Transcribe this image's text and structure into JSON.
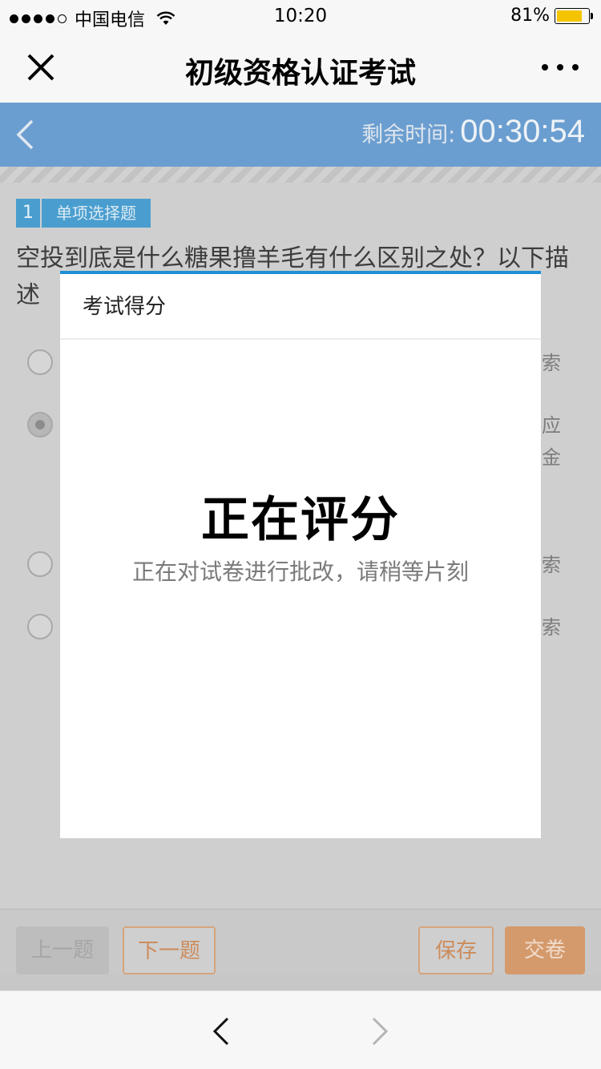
{
  "status_bar": {
    "carrier": "中国电信",
    "time": "10:20",
    "battery_percent": "81%",
    "battery_level": 0.81,
    "signal_bars": 4
  },
  "nav": {
    "title": "初级资格认证考试",
    "close_icon": "close-icon",
    "more_icon": "more-icon"
  },
  "exam_header": {
    "timer_label": "剩余时间:",
    "timer_value": "00:30:54"
  },
  "question": {
    "number": "1",
    "type": "单项选择题",
    "text": "空投到底是什么糖果撸羊毛有什么区别之处？以下描述"
  },
  "options": [
    {
      "fragment": "索",
      "checked": false
    },
    {
      "fragment": "应\n金",
      "checked": true
    },
    {
      "fragment": "索",
      "checked": false
    },
    {
      "fragment": "索",
      "checked": false
    }
  ],
  "toolbar": {
    "prev_label": "上一题",
    "next_label": "下一题",
    "save_label": "保存",
    "submit_label": "交卷"
  },
  "modal": {
    "title": "考试得分",
    "heading": "正在评分",
    "message": "正在对试卷进行批改，请稍等片刻"
  },
  "colors": {
    "accent_blue": "#1e8fd6",
    "header_blue": "#6b9ed0",
    "tag_blue": "#4a9ecf",
    "action_orange": "#d49a6c",
    "battery_yellow": "#f5c400"
  }
}
